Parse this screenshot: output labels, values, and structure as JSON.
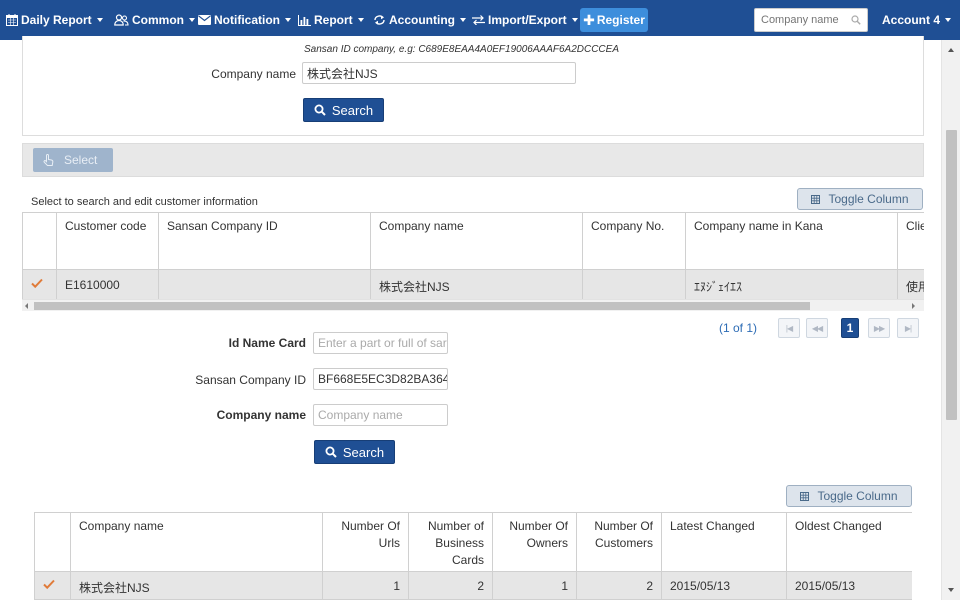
{
  "navbar": {
    "items": [
      {
        "label": "Daily Report",
        "icon": "calendar-icon"
      },
      {
        "label": "Common",
        "icon": "users-icon"
      },
      {
        "label": "Notification",
        "icon": "envelope-icon"
      },
      {
        "label": "Report",
        "icon": "bar-chart-icon"
      },
      {
        "label": "Accounting",
        "icon": "exchange-icon"
      },
      {
        "label": "Import/Export",
        "icon": "swap-icon"
      }
    ],
    "register_label": "Register",
    "search_placeholder": "Company name",
    "account_label": "Account 4"
  },
  "top_form": {
    "hint": "Sansan ID company, e.g: C689E8EAA4A0EF19006AAAF6A2DCCCEA",
    "company_label": "Company name",
    "company_value": "株式会社NJS",
    "search_label": "Search"
  },
  "toolbar": {
    "select_label": "Select"
  },
  "grid1": {
    "caption": "Select to search and edit customer information",
    "toggle_label": "Toggle Column",
    "columns": [
      "",
      "Customer code",
      "Sansan Company ID",
      "Company name",
      "Company No.",
      "Company name in Kana",
      "Clie"
    ],
    "rows": [
      [
        "",
        "E1610000",
        "",
        "株式会社NJS",
        "",
        "ｴﾇｼﾞｪｲｴｽ",
        "使用"
      ]
    ]
  },
  "pager": {
    "info": "(1 of 1)",
    "first": "|◀",
    "prev": "◀◀",
    "page": "1",
    "next": "▶▶",
    "last": "▶|"
  },
  "mid_form": {
    "idcard_label": "Id Name Card",
    "idcard_placeholder": "Enter a part or full of sar",
    "sansan_label": "Sansan Company ID",
    "sansan_value": "BF668E5EC3D82BA364",
    "company_label": "Company name",
    "company_placeholder": "Company name",
    "search_label": "Search"
  },
  "grid2": {
    "toggle_label": "Toggle Column",
    "columns": [
      {
        "l1": "",
        "l2": "",
        "l3": ""
      },
      {
        "l1": "Company name",
        "l2": "",
        "l3": ""
      },
      {
        "l1": "Number Of",
        "l2": "Urls",
        "l3": ""
      },
      {
        "l1": "Number of",
        "l2": "Business",
        "l3": "Cards"
      },
      {
        "l1": "Number Of",
        "l2": "Owners",
        "l3": ""
      },
      {
        "l1": "Number Of",
        "l2": "Customers",
        "l3": ""
      },
      {
        "l1": "Latest Changed",
        "l2": "",
        "l3": ""
      },
      {
        "l1": "Oldest Changed",
        "l2": "",
        "l3": ""
      }
    ],
    "rows": [
      [
        "",
        "株式会社NJS",
        "1",
        "2",
        "1",
        "2",
        "2015/05/13",
        "2015/05/13"
      ]
    ]
  },
  "colors": {
    "navbar": "#1f4f94",
    "register": "#3d8edc",
    "check": "#e07b39",
    "pager_link": "#2d6cb5"
  }
}
